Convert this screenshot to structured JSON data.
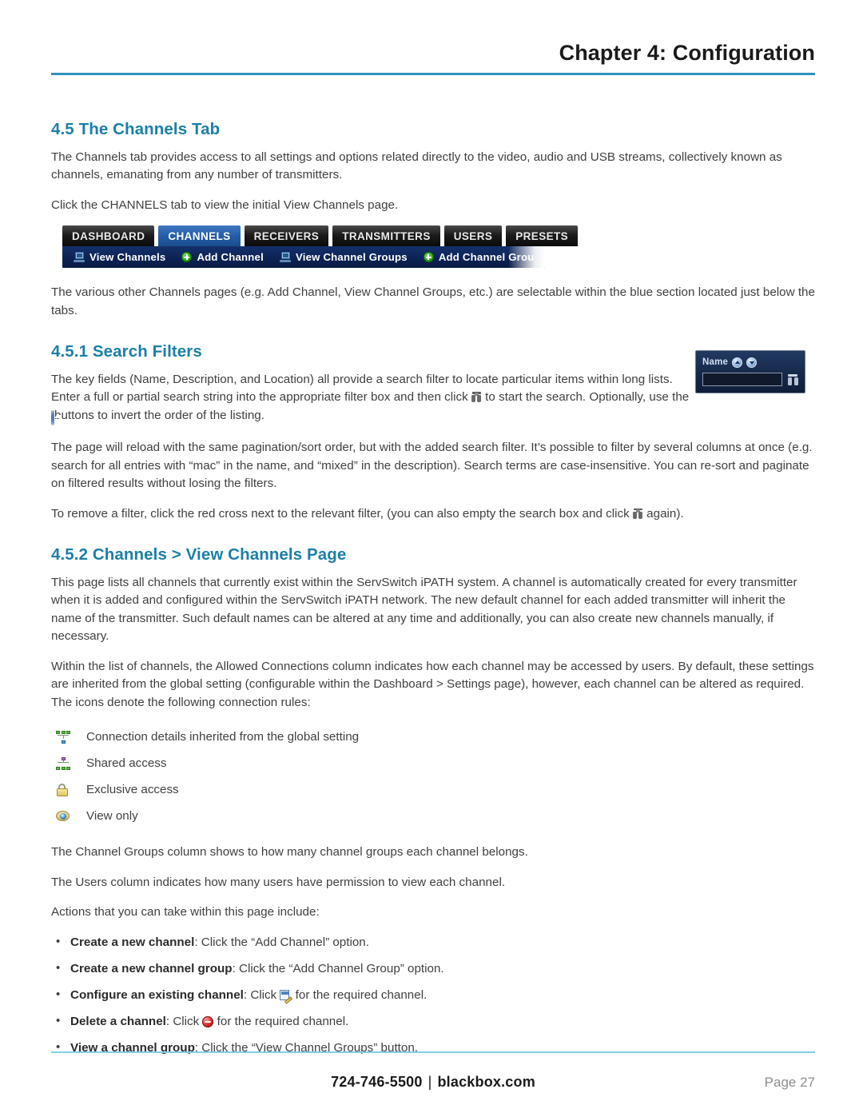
{
  "header": {
    "title": "Chapter 4: Configuration"
  },
  "sections": {
    "s45": {
      "heading": "4.5 The Channels Tab",
      "p1": "The Channels tab provides access to all settings and options related directly to the video, audio and USB streams, collectively known as channels, emanating from any number of transmitters.",
      "p2": "Click the CHANNELS tab to view the initial View Channels page.",
      "p3": "The various other Channels pages (e.g. Add Channel, View Channel Groups, etc.) are selectable within the blue section located just below the tabs."
    },
    "s451": {
      "heading": "4.5.1 Search Filters",
      "p1_a": "The key fields (Name, Description, and Location) all provide a search filter to locate particular items within long lists. Enter a full or partial search string into the appropriate filter box and then click ",
      "p1_b": " to start the search. Optionally, use the ",
      "p1_c": " buttons to invert the order of the listing.",
      "p2": "The page will reload with the same pagination/sort order, but with the added search filter. It’s possible to filter by several columns at once (e.g. search for all entries with “mac” in the name, and “mixed” in the description). Search terms are case-insensitive. You can re-sort and paginate on filtered results without losing the filters.",
      "p3_a": "To remove a filter, click the red cross next to the relevant filter, (you can also empty the search box and click ",
      "p3_b": " again)."
    },
    "s452": {
      "heading": "4.5.2 Channels > View Channels Page",
      "p1": "This page lists all channels that currently exist within the ServSwitch iPATH system. A channel is automatically created for every transmitter when it is added and configured within the ServSwitch iPATH network. The new default channel for each added transmitter will inherit the name of the transmitter. Such default names can be altered at any time and additionally, you can also create new channels manually, if necessary.",
      "p2": "Within the list of channels, the Allowed Connections column indicates how each channel may be accessed by users. By default, these settings are inherited from the global setting (configurable within the Dashboard > Settings page), however, each channel can be altered as required. The icons denote the following connection rules:",
      "p3": "The Channel Groups column shows to how many channel groups each channel belongs.",
      "p4": "The Users column indicates how many users have permission to view each channel.",
      "p5": "Actions that you can take within this page include:"
    }
  },
  "tabbar": {
    "tabs": [
      {
        "label": "DASHBOARD",
        "active": false
      },
      {
        "label": "CHANNELS",
        "active": true
      },
      {
        "label": "RECEIVERS",
        "active": false
      },
      {
        "label": "TRANSMITTERS",
        "active": false
      },
      {
        "label": "USERS",
        "active": false
      },
      {
        "label": "PRESETS",
        "active": false
      }
    ],
    "subnav": [
      {
        "label": "View Channels",
        "icon": "monitor-icon"
      },
      {
        "label": "Add Channel",
        "icon": "green-plus-icon"
      },
      {
        "label": "View Channel Groups",
        "icon": "monitor-icon"
      },
      {
        "label": "Add Channel Grou",
        "icon": "green-plus-icon"
      }
    ]
  },
  "filter_widget": {
    "label": "Name",
    "input_value": "",
    "sort_up_icon": "sort-ascending-icon",
    "sort_down_icon": "sort-descending-icon",
    "search_icon": "binoculars-icon"
  },
  "legend": [
    {
      "icon": "network-inherited-icon",
      "text": "Connection details inherited from the global setting"
    },
    {
      "icon": "network-shared-icon",
      "text": "Shared access"
    },
    {
      "icon": "padlock-icon",
      "text": "Exclusive access"
    },
    {
      "icon": "eye-icon",
      "text": "View only"
    }
  ],
  "bullets": [
    {
      "lead": "Create a new channel",
      "rest": ": Click the “Add Channel” option.",
      "icon": null,
      "tail": ""
    },
    {
      "lead": "Create a new channel group",
      "rest": ": Click the “Add Channel Group” option.",
      "icon": null,
      "tail": ""
    },
    {
      "lead": "Configure an existing channel",
      "rest": ": Click ",
      "icon": "edit-icon",
      "tail": " for the required channel."
    },
    {
      "lead": "Delete a channel",
      "rest": ": Click ",
      "icon": "delete-icon",
      "tail": " for the required channel."
    },
    {
      "lead": "View a channel group",
      "rest": ": Click the “View Channel Groups” button.",
      "icon": null,
      "tail": ""
    }
  ],
  "footer": {
    "phone": "724-746-5500",
    "separator": "|",
    "site": "blackbox.com",
    "page": "Page 27"
  },
  "colors": {
    "heading": "#1b7fa8",
    "header_rule": "#2e93bd",
    "footer_rule": "#7fd0e0",
    "active_tab": "#245ea8",
    "subnav": "#0d2355"
  }
}
